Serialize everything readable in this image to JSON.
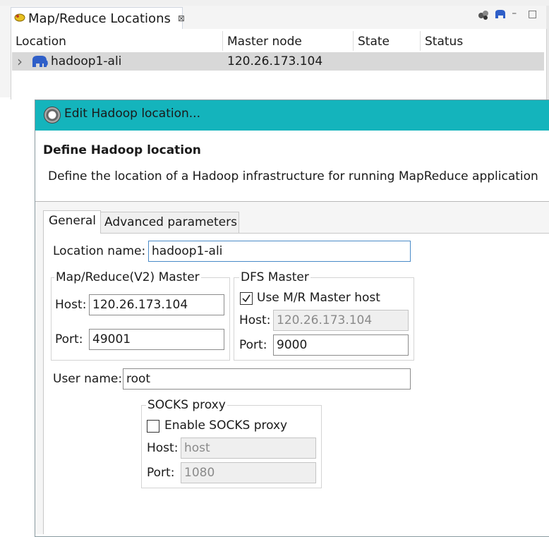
{
  "view": {
    "tab_title": "Map/Reduce Locations",
    "close_glyph": "⊠",
    "tool_min": "⎯",
    "tool_max": "□",
    "columns": [
      "Location",
      "Master node",
      "State",
      "Status"
    ],
    "rows": [
      {
        "expander": "›",
        "location": "hadoop1-ali",
        "master_node": "120.26.173.104",
        "state": "",
        "status": ""
      }
    ]
  },
  "dialog": {
    "title": "Edit Hadoop location...",
    "header_title": "Define Hadoop location",
    "header_desc": "Define the location of a Hadoop infrastructure for running MapReduce application",
    "tabs": [
      "General",
      "Advanced parameters"
    ],
    "location_name_label": "Location name:",
    "location_name_value": "hadoop1-ali",
    "mr_master": {
      "legend": "Map/Reduce(V2) Master",
      "host_label": "Host:",
      "host_value": "120.26.173.104",
      "port_label": "Port:",
      "port_value": "49001"
    },
    "dfs_master": {
      "legend": "DFS Master",
      "use_mr_host_label": "Use M/R Master host",
      "use_mr_host_checked": true,
      "host_label": "Host:",
      "host_value": "120.26.173.104",
      "port_label": "Port:",
      "port_value": "9000"
    },
    "user_name_label": "User name:",
    "user_name_value": "root",
    "socks": {
      "legend": "SOCKS proxy",
      "enable_label": "Enable SOCKS proxy",
      "enabled": false,
      "host_label": "Host:",
      "host_value": "host",
      "port_label": "Port:",
      "port_value": "1080"
    }
  },
  "colors": {
    "title_bar": "#14b4bc",
    "selected_row": "#d8d8d8",
    "focus_border": "#4a8bc8"
  },
  "icons": {
    "view_tab": "mapreduce-view-icon",
    "row": "elephant-location-icon",
    "dialog": "gear-icon",
    "toolbar": [
      "new-location-icon",
      "elephant-icon",
      "minimize-icon",
      "maximize-icon"
    ]
  }
}
